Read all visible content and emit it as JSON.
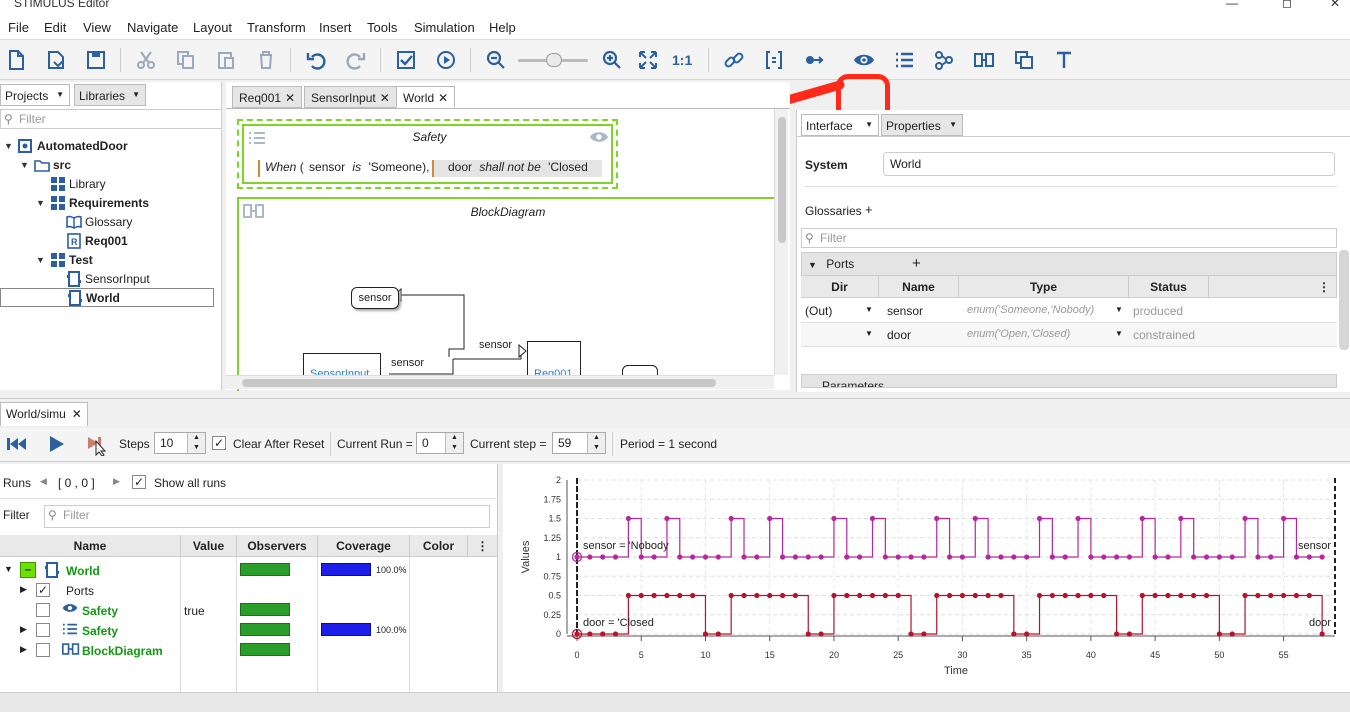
{
  "window": {
    "title": "STIMULUS Editor"
  },
  "menu": [
    "File",
    "Edit",
    "View",
    "Navigate",
    "Layout",
    "Transform",
    "Insert",
    "Tools",
    "Simulation",
    "Help"
  ],
  "toolbar": {
    "zoom_ratio_label": "1:1",
    "highlight_color": "#ff2a1a"
  },
  "projects": {
    "tab_projects": "Projects",
    "tab_libraries": "Libraries",
    "filter_placeholder": "Filter",
    "tree": [
      {
        "label": "AutomatedDoor",
        "bold": true,
        "level": 0,
        "expanded": true,
        "icon": "project-icon"
      },
      {
        "label": "src",
        "bold": true,
        "level": 1,
        "expanded": true,
        "icon": "folder-icon"
      },
      {
        "label": "Library",
        "bold": false,
        "level": 2,
        "icon": "library-icon"
      },
      {
        "label": "Requirements",
        "bold": true,
        "level": 2,
        "expanded": true,
        "icon": "library-icon"
      },
      {
        "label": "Glossary",
        "bold": false,
        "level": 3,
        "icon": "glossary-icon"
      },
      {
        "label": "Req001",
        "bold": true,
        "level": 3,
        "icon": "requirement-icon"
      },
      {
        "label": "Test",
        "bold": true,
        "level": 2,
        "expanded": true,
        "icon": "library-icon"
      },
      {
        "label": "SensorInput",
        "bold": false,
        "level": 3,
        "icon": "system-icon"
      },
      {
        "label": "World",
        "bold": true,
        "level": 3,
        "icon": "system-icon",
        "selected": true
      }
    ]
  },
  "editor": {
    "tabs": [
      "Req001",
      "SensorInput",
      "World"
    ],
    "safety": {
      "title": "Safety",
      "when": "When",
      "paren": "(",
      "sensor": "sensor",
      "is": "is",
      "someone": "'Someone",
      "close": ")",
      "comma": ",",
      "door": "door",
      "shall_not_be": "shall not be",
      "closed": "'Closed"
    },
    "block_diagram": {
      "title": "BlockDiagram",
      "port_sensor": "sensor",
      "wire_sensor_1": "sensor",
      "wire_sensor_2": "sensor",
      "block_sensorinput": "SensorInput",
      "block_req": "Req001"
    }
  },
  "properties": {
    "tab_interface": "Interface",
    "tab_properties": "Properties",
    "system_label": "System",
    "system_value": "World",
    "glossaries_label": "Glossaries",
    "glossaries_add": "+",
    "filter_placeholder": "Filter",
    "ports_label": "Ports",
    "ports_add": "+",
    "columns": [
      "Dir",
      "Name",
      "Type",
      "Status"
    ],
    "rows": [
      {
        "dir": "(Out)",
        "name": "sensor",
        "type": "enum('Someone,'Nobody)",
        "status": "produced"
      },
      {
        "dir": "",
        "name": "door",
        "type": "enum('Open,'Closed)",
        "status": "constrained"
      }
    ],
    "next_section": "Parameters"
  },
  "simulation": {
    "tab_label": "World/simu",
    "steps_label": "Steps",
    "steps_value": "10",
    "clear_after_reset": "Clear After Reset",
    "current_run_label": "Current Run =",
    "current_run_value": "0",
    "current_step_label": "Current step =",
    "current_step_value": "59",
    "period": "Period = 1 second",
    "runs_label": "Runs",
    "runs_range": "[ 0 , 0 ]",
    "show_all_runs": "Show all runs",
    "filter_label": "Filter",
    "filter_placeholder": "Filter",
    "columns": [
      "Name",
      "Value",
      "Observers",
      "Coverage",
      "Color"
    ],
    "rows": [
      {
        "name": "World",
        "value": "",
        "observers": 1,
        "coverage": "100.0%",
        "icon": "system-icon",
        "green": true
      },
      {
        "name": "Ports",
        "value": "",
        "icon": ""
      },
      {
        "name": "Safety",
        "value": "true",
        "observers": 1,
        "icon": "eye-icon",
        "green": true
      },
      {
        "name": "Safety",
        "value": "",
        "observers": 1,
        "coverage": "100.0%",
        "icon": "list-icon",
        "green": true
      },
      {
        "name": "BlockDiagram",
        "value": "",
        "observers": 1,
        "icon": "block-icon",
        "green": true
      }
    ]
  },
  "chart_data": {
    "type": "line",
    "xlabel": "Time",
    "ylabel": "Values",
    "xlim": [
      0,
      59
    ],
    "ylim": [
      0,
      2
    ],
    "xticks": [
      0,
      5,
      10,
      15,
      20,
      25,
      30,
      35,
      40,
      45,
      50,
      55
    ],
    "yticks": [
      0,
      0.25,
      0.5,
      0.75,
      1,
      1.25,
      1.5,
      1.75,
      2
    ],
    "grid": true,
    "series": [
      {
        "name": "sensor",
        "color": "#b5279b",
        "start_label": "sensor = 'Nobody",
        "x": [
          0,
          1,
          2,
          3,
          4,
          5,
          6,
          7,
          8,
          9,
          10,
          11,
          12,
          13,
          14,
          15,
          16,
          17,
          18,
          19,
          20,
          21,
          22,
          23,
          24,
          25,
          26,
          27,
          28,
          29,
          30,
          31,
          32,
          33,
          34,
          35,
          36,
          37,
          38,
          39,
          40,
          41,
          42,
          43,
          44,
          45,
          46,
          47,
          48,
          49,
          50,
          51,
          52,
          53,
          54,
          55,
          56,
          57,
          58
        ],
        "values": [
          1,
          1,
          1,
          1,
          1.5,
          1,
          1,
          1.5,
          1,
          1,
          1,
          1,
          1.5,
          1,
          1,
          1.5,
          1,
          1,
          1,
          1,
          1.5,
          1,
          1,
          1.5,
          1,
          1,
          1,
          1,
          1.5,
          1,
          1,
          1.5,
          1,
          1,
          1,
          1,
          1.5,
          1,
          1,
          1.5,
          1,
          1,
          1,
          1,
          1.5,
          1,
          1,
          1.5,
          1,
          1,
          1,
          1,
          1.5,
          1,
          1,
          1.5,
          1,
          1,
          1
        ]
      },
      {
        "name": "door",
        "color": "#b3142a",
        "start_label": "door = 'Closed",
        "x": [
          0,
          1,
          2,
          3,
          4,
          5,
          6,
          7,
          8,
          9,
          10,
          11,
          12,
          13,
          14,
          15,
          16,
          17,
          18,
          19,
          20,
          21,
          22,
          23,
          24,
          25,
          26,
          27,
          28,
          29,
          30,
          31,
          32,
          33,
          34,
          35,
          36,
          37,
          38,
          39,
          40,
          41,
          42,
          43,
          44,
          45,
          46,
          47,
          48,
          49,
          50,
          51,
          52,
          53,
          54,
          55,
          56,
          57,
          58
        ],
        "values": [
          0,
          0,
          0,
          0,
          0.5,
          0.5,
          0.5,
          0.5,
          0.5,
          0.5,
          0,
          0,
          0.5,
          0.5,
          0.5,
          0.5,
          0.5,
          0.5,
          0,
          0,
          0.5,
          0.5,
          0.5,
          0.5,
          0.5,
          0.5,
          0,
          0,
          0.5,
          0.5,
          0.5,
          0.5,
          0.5,
          0.5,
          0,
          0,
          0.5,
          0.5,
          0.5,
          0.5,
          0.5,
          0.5,
          0,
          0,
          0.5,
          0.5,
          0.5,
          0.5,
          0.5,
          0.5,
          0,
          0,
          0.5,
          0.5,
          0.5,
          0.5,
          0.5,
          0.5,
          0
        ]
      }
    ]
  }
}
